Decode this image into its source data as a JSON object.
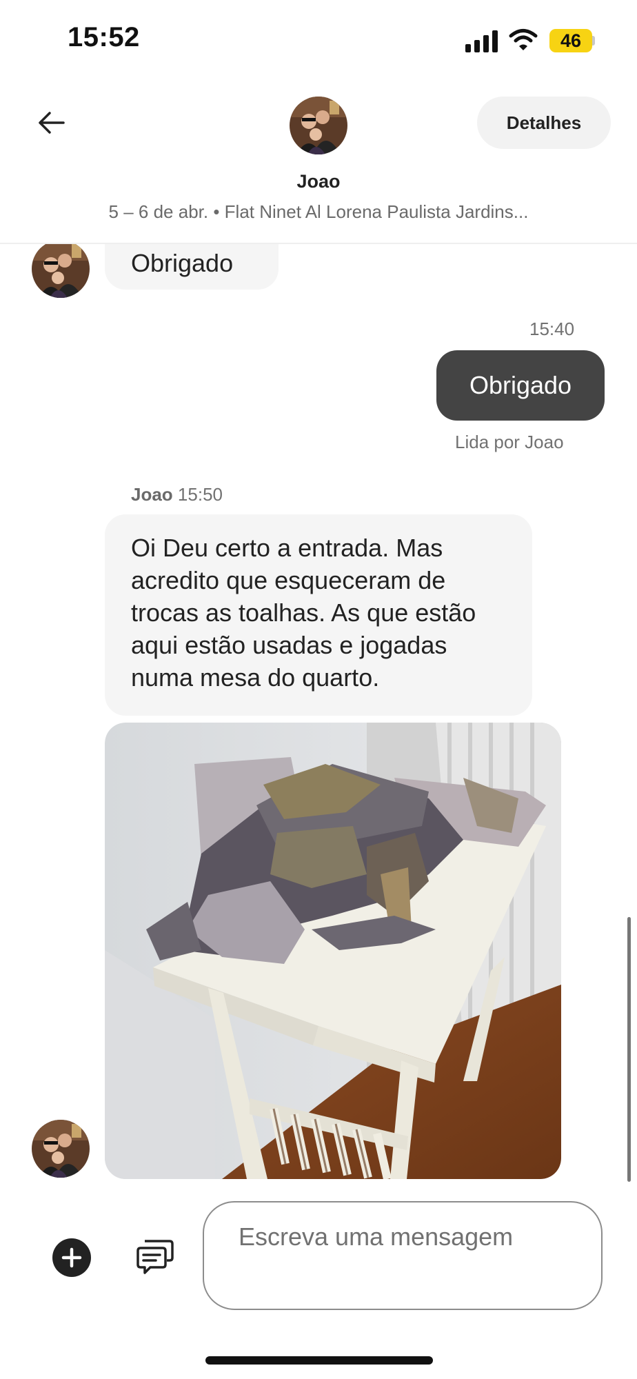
{
  "status_bar": {
    "time": "15:52",
    "battery": "46",
    "icons": [
      "signal-icon",
      "wifi-icon"
    ],
    "battery_color": "#f7d313"
  },
  "header": {
    "back_icon": "arrow-left-icon",
    "name": "Joao",
    "subtitle": "5 – 6 de abr. • Flat Ninet Al Lorena Paulista Jardins...",
    "details_label": "Detalhes"
  },
  "messages": [
    {
      "direction": "in",
      "text": "Obrigado"
    },
    {
      "direction": "out",
      "time": "15:40",
      "text": "Obrigado",
      "receipt": "Lida por Joao"
    },
    {
      "direction": "in",
      "sender": "Joao",
      "time": "15:50",
      "text": "Oi Deu certo a entrada. Mas acredito que esqueceram de trocas as toalhas. As que estão aqui estão usadas e jogadas numa mesa do quarto."
    }
  ],
  "composer": {
    "placeholder": "Escreva uma mensagem",
    "icons": [
      "plus-icon",
      "quick-replies-icon"
    ]
  },
  "colors": {
    "outgoing_bubble": "#444444",
    "incoming_bubble": "#f5f5f5",
    "text_primary": "#222222",
    "text_secondary": "#717171"
  }
}
